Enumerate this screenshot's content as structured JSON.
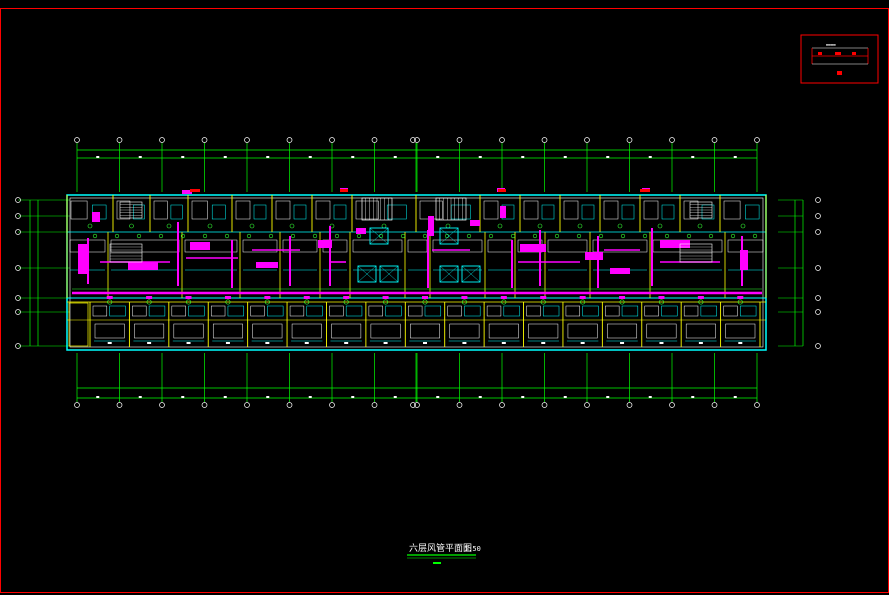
{
  "drawing": {
    "title": "六层风管平面图",
    "scale": "1:50",
    "legend_text": "",
    "colors": {
      "background": "#000000",
      "frame": "#ff0000",
      "axis": "#00ff00",
      "wall_outer": "#00ffff",
      "wall_inner": "#ffff00",
      "duct": "#ff00ff",
      "fixture": "#ffffff",
      "diffuser": "#33ff33",
      "text": "#ffffff"
    }
  },
  "grid": {
    "columns": 17,
    "rows": 6
  }
}
